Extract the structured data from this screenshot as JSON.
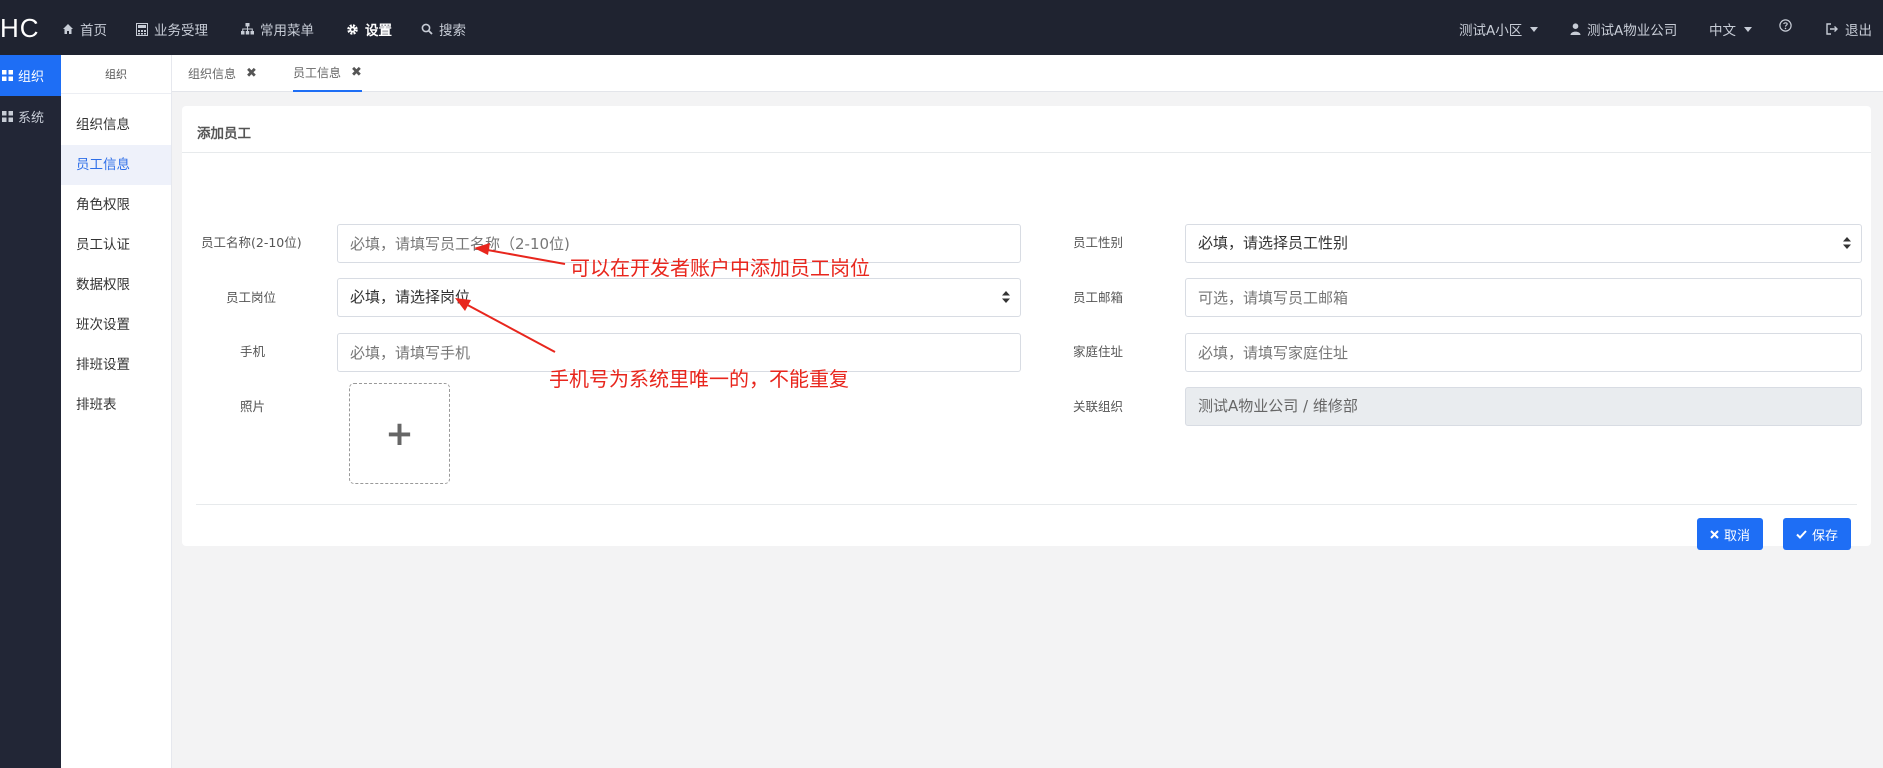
{
  "topbar": {
    "brand": "HC",
    "nav": [
      {
        "icon": "home-icon",
        "label": "首页"
      },
      {
        "icon": "calculator-icon",
        "label": "业务受理"
      },
      {
        "icon": "sitemap-icon",
        "label": "常用菜单"
      },
      {
        "icon": "gear-icon",
        "label": "设置"
      },
      {
        "icon": "search-icon",
        "label": "搜索"
      }
    ],
    "community": "测试A小区",
    "company": "测试A物业公司",
    "language": "中文",
    "help_icon": "question-circle-icon",
    "logout": "退出"
  },
  "rail": {
    "items": [
      {
        "icon": "grid-icon",
        "label": "组织"
      },
      {
        "icon": "grid-icon",
        "label": "系统"
      }
    ]
  },
  "submenu": {
    "title": "组织",
    "items": [
      "组织信息",
      "员工信息",
      "角色权限",
      "员工认证",
      "数据权限",
      "班次设置",
      "排班设置",
      "排班表"
    ]
  },
  "tabs": [
    {
      "label": "组织信息",
      "close": "✖"
    },
    {
      "label": "员工信息",
      "close": "✖"
    }
  ],
  "form": {
    "title": "添加员工",
    "name_label": "员工名称(2-10位)",
    "name_placeholder": "必填，请填写员工名称（2-10位)",
    "position_label": "员工岗位",
    "position_value": "必填，请选择岗位",
    "phone_label": "手机",
    "phone_placeholder": "必填，请填写手机",
    "photo_label": "照片",
    "photo_add": "+",
    "gender_label": "员工性别",
    "gender_value": "必填，请选择员工性别",
    "email_label": "员工邮箱",
    "email_placeholder": "可选，请填写员工邮箱",
    "address_label": "家庭住址",
    "address_placeholder": "必填，请填写家庭住址",
    "org_label": "关联组织",
    "org_value": "测试A物业公司 / 维修部",
    "cancel_label": "取消",
    "save_label": "保存"
  },
  "annotations": {
    "position_note": "可以在开发者账户中添加员工岗位",
    "phone_note": "手机号为系统里唯一的，不能重复"
  },
  "colors": {
    "topbar_bg": "#1f2330",
    "rail_bg": "#222636",
    "accent": "#1e6ef5",
    "annotation": "#e8261d"
  }
}
